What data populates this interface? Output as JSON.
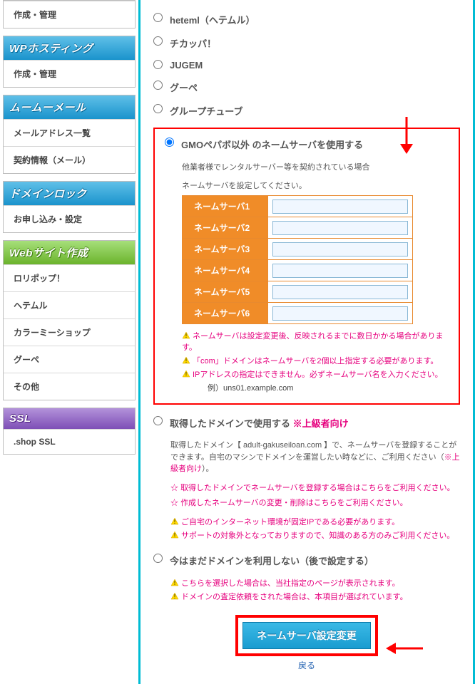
{
  "sidebar": {
    "groups": [
      {
        "header_class": "blue",
        "header": "",
        "items": [
          "作成・管理"
        ]
      },
      {
        "header_class": "blue",
        "header": "WPホスティング",
        "items": [
          "作成・管理"
        ]
      },
      {
        "header_class": "blue",
        "header": "ムームーメール",
        "items": [
          "メールアドレス一覧",
          "契約情報（メール）"
        ]
      },
      {
        "header_class": "blue",
        "header": "ドメインロック",
        "items": [
          "お申し込み・設定"
        ]
      },
      {
        "header_class": "green",
        "header": "Webサイト作成",
        "items": [
          "ロリポップ！",
          "ヘテムル",
          "カラーミーショップ",
          "グーペ",
          "その他"
        ]
      },
      {
        "header_class": "purple",
        "header": "SSL",
        "items": [
          ".shop SSL"
        ]
      }
    ]
  },
  "main": {
    "providers": [
      {
        "label": "heteml（ヘテムル）"
      },
      {
        "label": "チカッパ！"
      },
      {
        "label": "JUGEM"
      },
      {
        "label": "グーペ"
      },
      {
        "label": "グループチューブ"
      }
    ],
    "external_ns": {
      "label": "GMOペパボ以外 のネームサーバを使用する",
      "subnote": "他業者様でレンタルサーバー等を契約されている場合",
      "instruction": "ネームサーバを設定してください。",
      "rows": [
        "ネームサーバ1",
        "ネームサーバ2",
        "ネームサーバ3",
        "ネームサーバ4",
        "ネームサーバ5",
        "ネームサーバ6"
      ],
      "warns": [
        "ネームサーバは設定変更後、反映されるまでに数日かかる場合があります。",
        "「com」ドメインはネームサーバを2個以上指定する必要があります。",
        "IPアドレスの指定はできません。必ずネームサーバ名を入力ください。"
      ],
      "example": "例）uns01.example.com"
    },
    "own_domain": {
      "label": "取得したドメインで使用する ",
      "advanced_tag": "※上級者向け",
      "desc_pre": "取得したドメイン【 adult-gakuseiloan.com 】で、ネームサーバを登録することができます。自宅のマシンでドメインを運営したい時などに、ご利用ください（",
      "desc_pink": "※上級者向け",
      "desc_post": "）。",
      "infos": [
        "取得したドメインでネームサーバを登録する場合はこちらをご利用ください。",
        "作成したネームサーバの変更・削除はこちらをご利用ください。"
      ],
      "warns": [
        "ご自宅のインターネット環境が固定IPである必要があります。",
        "サポートの対象外となっておりますので、知識のある方のみご利用ください。"
      ]
    },
    "no_use": {
      "label": "今はまだドメインを利用しない（後で設定する）",
      "warns": [
        "こちらを選択した場合は、当社指定のページが表示されます。",
        "ドメインの査定依頼をされた場合は、本項目が選ばれています。"
      ]
    },
    "submit_label": "ネームサーバ設定変更",
    "back_label": "戻る"
  }
}
